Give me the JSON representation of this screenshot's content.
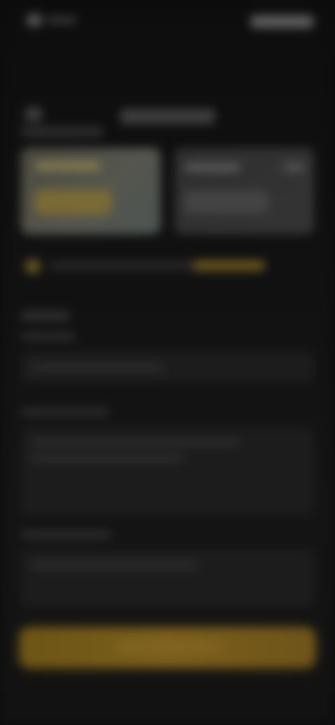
{
  "theme": {
    "background": "#0b0b0c",
    "accent": "#7b5e1b",
    "card_highlight": "#55564d"
  },
  "icons": {
    "back": "chevron-left-icon",
    "promo": "gift-icon",
    "status_right": "battery-icon"
  },
  "status_bar": {},
  "header": {},
  "plans": {},
  "promo": {},
  "form": {},
  "footer": {}
}
